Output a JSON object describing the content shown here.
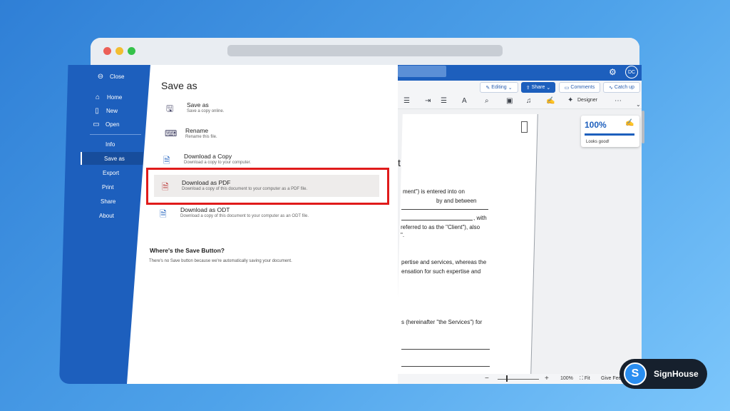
{
  "word": {
    "avatar_initials": "DC",
    "editing_label": "Editing",
    "share_label": "Share",
    "comments_label": "Comments",
    "catchup_label": "Catch up",
    "designer_label": "Designer"
  },
  "backstage": {
    "close_label": "Close",
    "items": [
      {
        "label": "Home",
        "icon": "home-icon"
      },
      {
        "label": "New",
        "icon": "new-document-icon"
      },
      {
        "label": "Open",
        "icon": "folder-icon"
      }
    ],
    "sub_items": [
      "Info",
      "Save as",
      "Export",
      "Print",
      "Share",
      "About"
    ],
    "active": "Save as"
  },
  "panel": {
    "title": "Save as",
    "options": [
      {
        "title": "Save as",
        "desc": "Save a copy online.",
        "icon": "save-as-icon"
      },
      {
        "title": "Rename",
        "desc": "Rename this file.",
        "icon": "rename-icon"
      },
      {
        "title": "Download a Copy",
        "desc": "Download a copy to your computer.",
        "icon": "word-file-icon"
      },
      {
        "title": "Download as PDF",
        "desc": "Download a copy of this document to your computer as a PDF file.",
        "icon": "pdf-file-icon"
      },
      {
        "title": "Download as ODT",
        "desc": "Download a copy of this document to your computer as an ODT file.",
        "icon": "odt-file-icon"
      }
    ],
    "save_button_title": "Where's the Save Button?",
    "save_button_desc": "There's no Save button because we're automatically saving your document."
  },
  "document": {
    "heading_fragment": "t",
    "lines": [
      "ment\") is entered into on",
      "by and between",
      ", with",
      "referred to as the \"Client\"), also",
      "\".",
      "pertise and services, whereas the",
      "ensation for such expertise and",
      "s (hereinafter \"the Services\") for"
    ]
  },
  "status_card": {
    "percent": "100%",
    "message": "Looks good!"
  },
  "statusbar": {
    "zoom": "100%",
    "fit": "Fit",
    "feedback": "Give Fee"
  },
  "badge": {
    "logo_letter": "S",
    "name": "SignHouse"
  },
  "colors": {
    "word_blue": "#1d5fbd",
    "highlight_red": "#e01b1b",
    "background_blue": "#4fa3ea"
  }
}
